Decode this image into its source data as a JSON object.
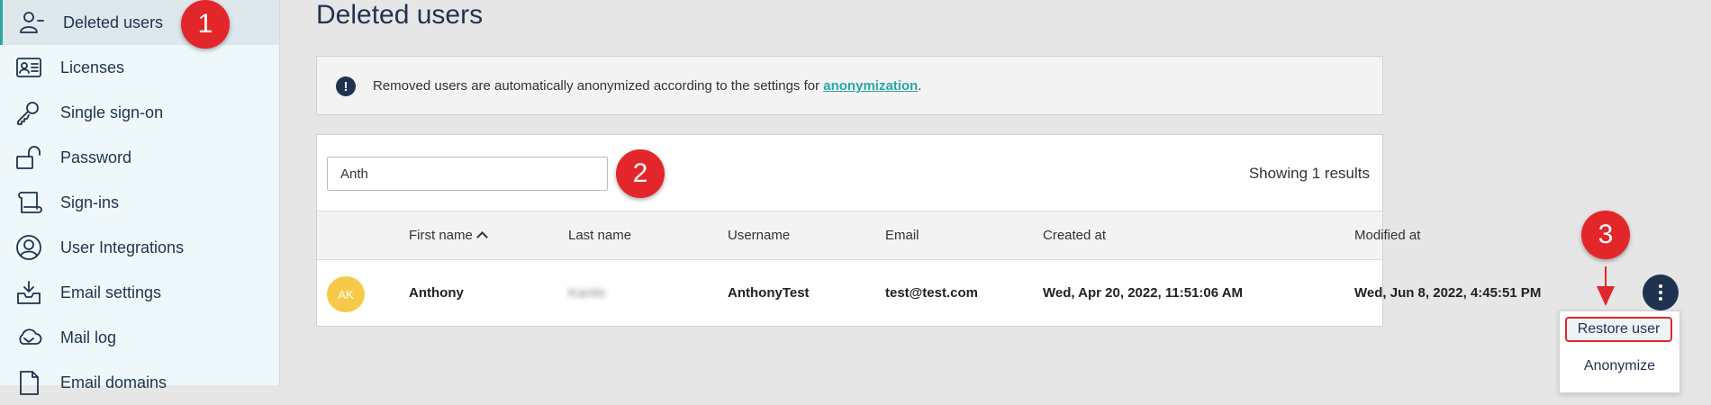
{
  "sidebar": {
    "items": [
      {
        "label": "Deleted users",
        "icon": "user-minus-icon",
        "active": true
      },
      {
        "label": "Licenses",
        "icon": "id-card-icon"
      },
      {
        "label": "Single sign-on",
        "icon": "key-icon"
      },
      {
        "label": "Password",
        "icon": "unlock-icon"
      },
      {
        "label": "Sign-ins",
        "icon": "scroll-icon"
      },
      {
        "label": "User Integrations",
        "icon": "user-circle-icon"
      },
      {
        "label": "Email settings",
        "icon": "inbox-download-icon"
      },
      {
        "label": "Mail log",
        "icon": "cloud-mail-icon"
      },
      {
        "label": "Email domains",
        "icon": "document-icon"
      }
    ]
  },
  "page": {
    "title": "Deleted users"
  },
  "info": {
    "text": "Removed users are automatically anonymized according to the settings for ",
    "link": "anonymization",
    "suffix": "."
  },
  "search": {
    "value": "Anth"
  },
  "results": {
    "text": "Showing 1 results"
  },
  "table": {
    "columns": [
      "First name",
      "Last name",
      "Username",
      "Email",
      "Created at",
      "Modified at"
    ],
    "rows": [
      {
        "initials": "AK",
        "first_name": "Anthony",
        "last_name": "Kanits",
        "username": "AnthonyTest",
        "email": "test@test.com",
        "created_at": "Wed, Apr 20, 2022, 11:51:06 AM",
        "modified_at": "Wed, Jun 8, 2022, 4:45:51 PM"
      }
    ]
  },
  "menu": {
    "items": [
      "Restore user",
      "Anonymize"
    ]
  },
  "callouts": [
    "1",
    "2",
    "3"
  ],
  "colors": {
    "accent": "#2aa7a7",
    "navy": "#1f3350",
    "callout": "#e3262a",
    "avatar": "#f6c948"
  }
}
